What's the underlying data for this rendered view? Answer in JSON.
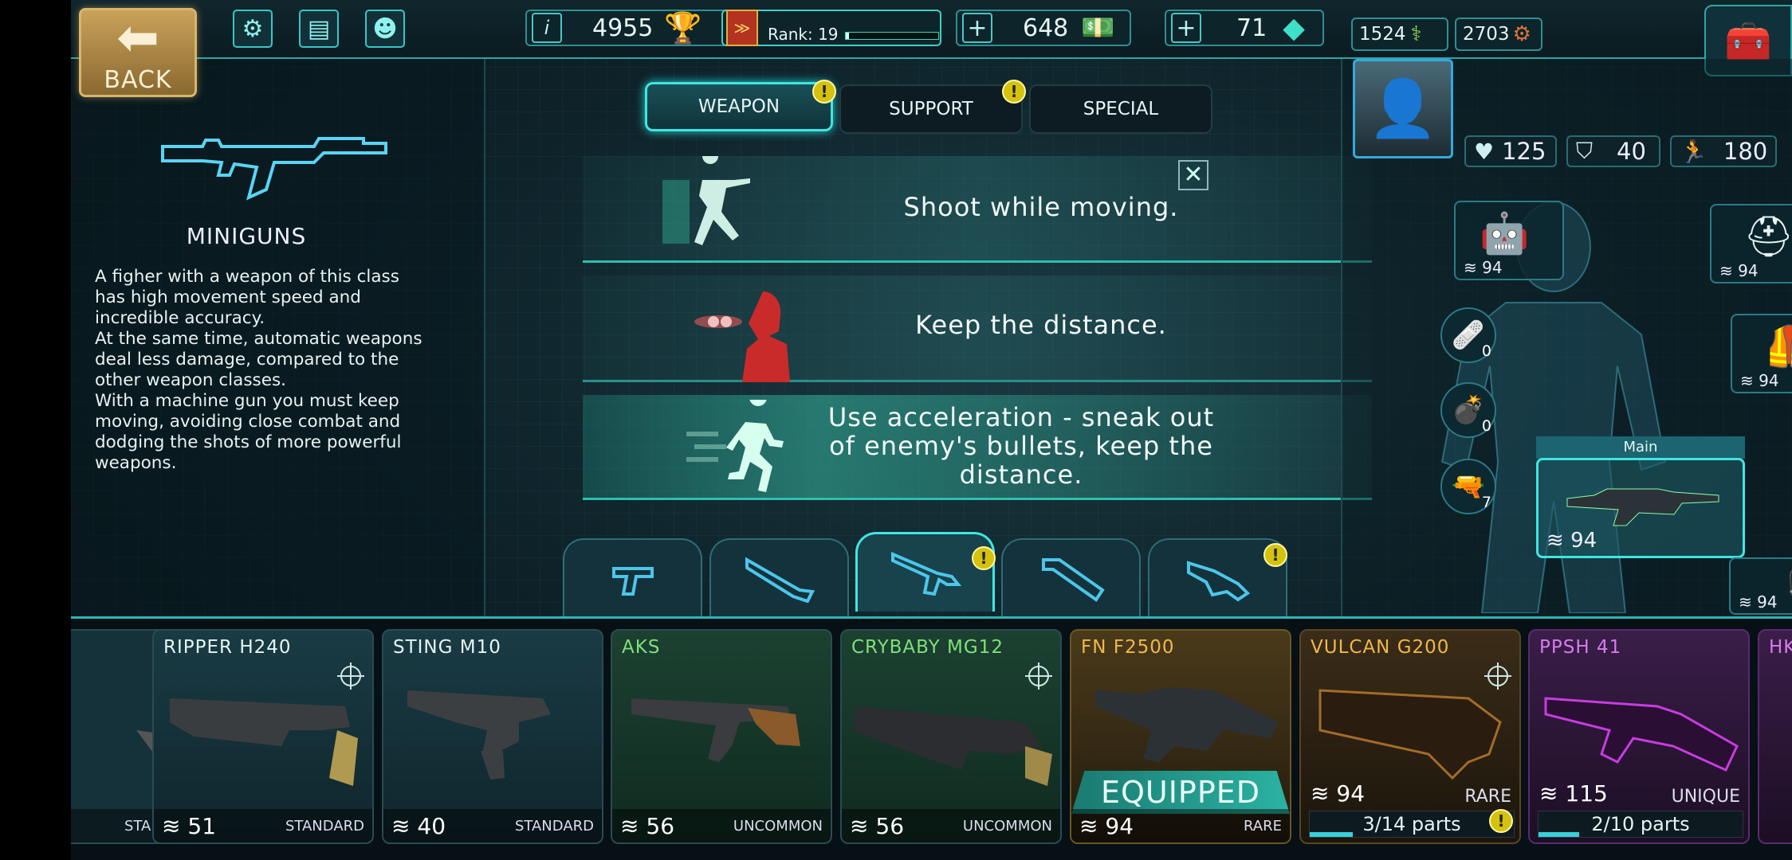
{
  "topbar": {
    "back_label": "BACK",
    "settings_icon": "gear-icon",
    "missions_icon": "notebook-icon",
    "friends_icon": "friends-icon",
    "rating_value": "4955",
    "rank_label": "Rank: 19",
    "rank_progress": 0.04,
    "money_value": "648",
    "crystals_value": "71",
    "dna_value": "1524",
    "parts_value": "2703"
  },
  "left_panel": {
    "class_title": "MINIGUNS",
    "class_description": "A figher with a weapon of this class\nhas high movement speed and\nincredible accuracy.\nAt the same time, automatic weapons\ndeal less damage, compared to the\nother weapon classes.\nWith a machine gun you must keep\nmoving, avoiding close combat and\ndodging the shots of more powerful\nweapons."
  },
  "tabs": [
    {
      "label": "WEAPON",
      "active": true,
      "badge": "!"
    },
    {
      "label": "SUPPORT",
      "active": false,
      "badge": "!"
    },
    {
      "label": "SPECIAL",
      "active": false,
      "badge": ""
    }
  ],
  "tips": [
    {
      "text": "Shoot  while  moving."
    },
    {
      "text": "Keep  the  distance."
    },
    {
      "text": "Use  acceleration  -  sneak  out\nof  enemy's  bullets,  keep\nthe  distance."
    }
  ],
  "categories": [
    {
      "icon": "pistol-icon",
      "badge": ""
    },
    {
      "icon": "shotgun-icon",
      "badge": ""
    },
    {
      "icon": "rifle-icon",
      "badge": "!",
      "active": true
    },
    {
      "icon": "launcher-icon",
      "badge": ""
    },
    {
      "icon": "heavy-icon",
      "badge": "!"
    }
  ],
  "hero": {
    "health": "125",
    "armor": "40",
    "speed": "180",
    "slots": {
      "drone_level": "94",
      "helmet_level": "94",
      "armor_level": "94",
      "medkit_count": "0",
      "grenade_count": "0",
      "gadget_count": "7",
      "main_label": "Main",
      "main_level": "94",
      "secondary_level": "94"
    }
  },
  "cards": [
    {
      "name": "",
      "level": "",
      "rarity": "STANDARD",
      "color": "#1a3a44"
    },
    {
      "name": "RIPPER  H240",
      "level": "51",
      "rarity": "STANDARD",
      "color": "#17343d"
    },
    {
      "name": "STING  M10",
      "level": "40",
      "rarity": "STANDARD",
      "color": "#17343d"
    },
    {
      "name": "AKS",
      "level": "56",
      "rarity": "UNCOMMON",
      "color": "#173a2a"
    },
    {
      "name": "CRYBABY  MG12",
      "level": "56",
      "rarity": "UNCOMMON",
      "color": "#173a2a"
    },
    {
      "name": "FN  F2500",
      "level": "94",
      "rarity": "RARE",
      "color": "#3a2e17",
      "equipped": "EQUIPPED"
    },
    {
      "name": "VULCAN  G200",
      "level": "94",
      "rarity": "RARE",
      "color": "#2c2418",
      "parts": "3/14  parts",
      "parts_fill": 0.21
    },
    {
      "name": "PPSH  41",
      "level": "115",
      "rarity": "UNIQUE",
      "color": "#2a1a33",
      "parts": "2/10  parts",
      "parts_fill": 0.2
    },
    {
      "name": "HK",
      "level": "",
      "rarity": "",
      "color": "#2a1a33"
    }
  ]
}
